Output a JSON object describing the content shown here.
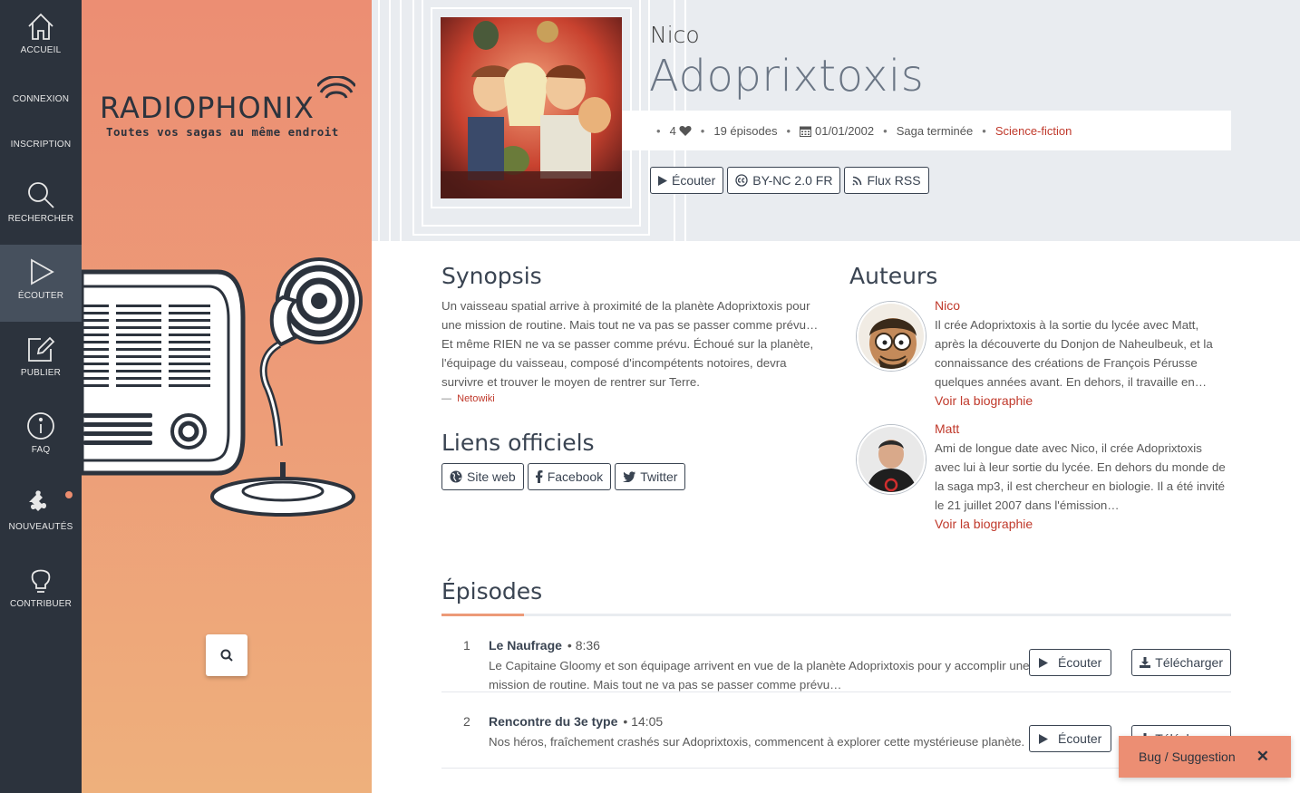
{
  "nav": {
    "items": [
      {
        "label": "ACCUEIL",
        "icon": "home-icon"
      },
      {
        "label": "CONNEXION"
      },
      {
        "label": "INSCRIPTION"
      },
      {
        "label": "RECHERCHER",
        "icon": "search-icon"
      },
      {
        "label": "ÉCOUTER",
        "icon": "play-icon",
        "active": true
      },
      {
        "label": "PUBLIER",
        "icon": "edit-icon"
      },
      {
        "label": "FAQ",
        "icon": "info-icon"
      },
      {
        "label": "NOUVEAUTÉS",
        "icon": "puzzle-icon",
        "has_badge": true
      },
      {
        "label": "CONTRIBUER",
        "icon": "lightbulb-icon"
      }
    ]
  },
  "brand": {
    "logo": "RADIOPHONIX",
    "tagline": "Toutes vos sagas au même endroit",
    "accent": "#ec8e73"
  },
  "saga": {
    "author": "Nico",
    "title": "Adoprixtoxis",
    "likes": "4",
    "episodes_count": "19 épisodes",
    "date": "01/01/2002",
    "status": "Saga terminée",
    "genre": "Science-fiction",
    "buttons": {
      "listen": "Écouter",
      "license": "BY-NC 2.0 FR",
      "rss": "Flux RSS"
    }
  },
  "synopsis": {
    "heading": "Synopsis",
    "text": "Un vaisseau spatial arrive à proximité de la planète Adoprixtoxis pour une mission de routine. Mais tout ne va pas se passer comme prévu… Et même RIEN ne va se passer comme prévu. Échoué sur la planète, l'équipage du vaisseau, composé d'incompétents notoires, devra survivre et trouver le moyen de rentrer sur Terre.",
    "source_dash": "—",
    "source": "Netowiki"
  },
  "links": {
    "heading": "Liens officiels",
    "website": "Site web",
    "facebook": "Facebook",
    "twitter": "Twitter"
  },
  "authors": {
    "heading": "Auteurs",
    "list": [
      {
        "name": "Nico",
        "bio": "Il crée Adoprixtoxis à la sortie du lycée avec Matt, après la découverte du Donjon de Naheulbeuk, et la connaissance des créations de François Pérusse quelques années avant. En dehors, il travaille en…",
        "link": "Voir la biographie"
      },
      {
        "name": "Matt",
        "bio": "Ami de longue date avec Nico, il crée Adoprixtoxis avec lui à leur sortie du lycée. En dehors du monde de la saga mp3, il est chercheur en biologie. Il a été invité le 21 juillet 2007 dans l'émission…",
        "link": "Voir la biographie"
      }
    ]
  },
  "episodes": {
    "heading": "Épisodes",
    "listen_label": "Écouter",
    "download_label": "Télécharger",
    "list": [
      {
        "num": "1",
        "title": "Le Naufrage",
        "duration": "• 8:36",
        "desc": "Le Capitaine Gloomy et son équipage arrivent en vue de la planète Adoprixtoxis pour y accomplir une mission de routine. Mais tout ne va pas se passer comme prévu…"
      },
      {
        "num": "2",
        "title": "Rencontre du 3e type",
        "duration": "• 14:05",
        "desc": "Nos héros, fraîchement crashés sur Adoprixtoxis, commencent à explorer cette mystérieuse planète."
      }
    ]
  },
  "feedback": {
    "label": "Bug / Suggestion",
    "close": "✕"
  }
}
